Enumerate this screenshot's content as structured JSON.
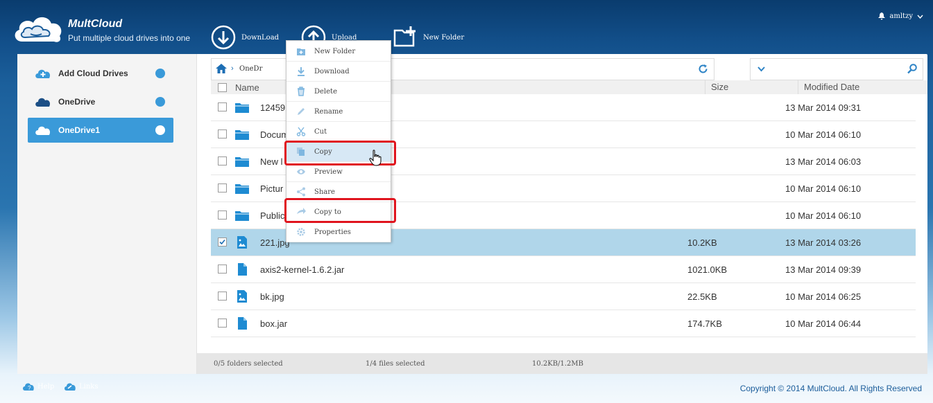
{
  "app": {
    "name": "MultCloud",
    "tagline": "Put multiple cloud drives into one"
  },
  "toolbar": {
    "download": "DownLoad",
    "upload": "Upload",
    "new_folder": "New Folder"
  },
  "user": {
    "name": "amltzy"
  },
  "sidebar": {
    "items": [
      {
        "label": "Add Cloud Drives"
      },
      {
        "label": "OneDrive"
      },
      {
        "label": "OneDrive1"
      }
    ]
  },
  "path": {
    "segment": "OneDr"
  },
  "table": {
    "headers": {
      "name": "Name",
      "size": "Size",
      "modified": "Modified Date"
    },
    "rows": [
      {
        "name": "12459",
        "size": "",
        "date": "13 Mar 2014 09:31",
        "type": "folder"
      },
      {
        "name": "Docum",
        "size": "",
        "date": "10 Mar 2014 06:10",
        "type": "folder"
      },
      {
        "name": "New l",
        "size": "",
        "date": "13 Mar 2014 06:03",
        "type": "folder"
      },
      {
        "name": "Pictur",
        "size": "",
        "date": "10 Mar 2014 06:10",
        "type": "folder"
      },
      {
        "name": "Public",
        "size": "",
        "date": "10 Mar 2014 06:10",
        "type": "folder"
      },
      {
        "name": "221.jpg",
        "size": "10.2KB",
        "date": "13 Mar 2014 03:26",
        "type": "image"
      },
      {
        "name": "axis2-kernel-1.6.2.jar",
        "size": "1021.0KB",
        "date": "13 Mar 2014 09:39",
        "type": "file"
      },
      {
        "name": "bk.jpg",
        "size": "22.5KB",
        "date": "10 Mar 2014 06:25",
        "type": "image"
      },
      {
        "name": "box.jar",
        "size": "174.7KB",
        "date": "10 Mar 2014 06:44",
        "type": "file"
      }
    ]
  },
  "status": {
    "folders": "0/5 folders selected",
    "files": "1/4 files selected",
    "size": "10.2KB/1.2MB"
  },
  "context_menu": {
    "items": [
      {
        "label": "New Folder"
      },
      {
        "label": "Download"
      },
      {
        "label": "Delete"
      },
      {
        "label": "Rename"
      },
      {
        "label": "Cut"
      },
      {
        "label": "Copy"
      },
      {
        "label": "Preview"
      },
      {
        "label": "Share"
      },
      {
        "label": "Copy to"
      },
      {
        "label": "Properties"
      }
    ]
  },
  "footer": {
    "help": "Help",
    "links": "Links",
    "copyright": "Copyright © 2014 MultCloud. All Rights Reserved"
  },
  "colors": {
    "accent": "#3a9ad9",
    "highlight": "#e0141e",
    "selected_row": "#b0d6ea"
  }
}
